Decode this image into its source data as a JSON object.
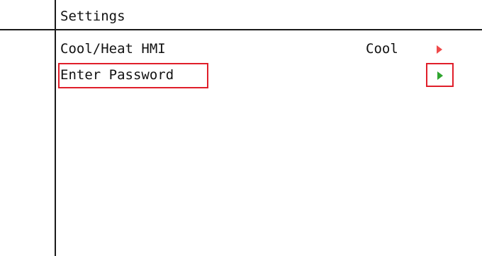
{
  "header": {
    "title": "Settings"
  },
  "rows": [
    {
      "label": "Cool/Heat HMI",
      "value": "Cool",
      "arrow_icon": "play-arrow-icon",
      "arrow_color": "#ef4a4a"
    },
    {
      "label": "Enter Password",
      "value": "",
      "arrow_icon": "play-arrow-icon",
      "arrow_color": "#2fa52f",
      "highlighted": true
    }
  ],
  "colors": {
    "highlight_border": "#e01e2a",
    "grid_lines": "#1a1a1a",
    "background": "#ffffff"
  }
}
